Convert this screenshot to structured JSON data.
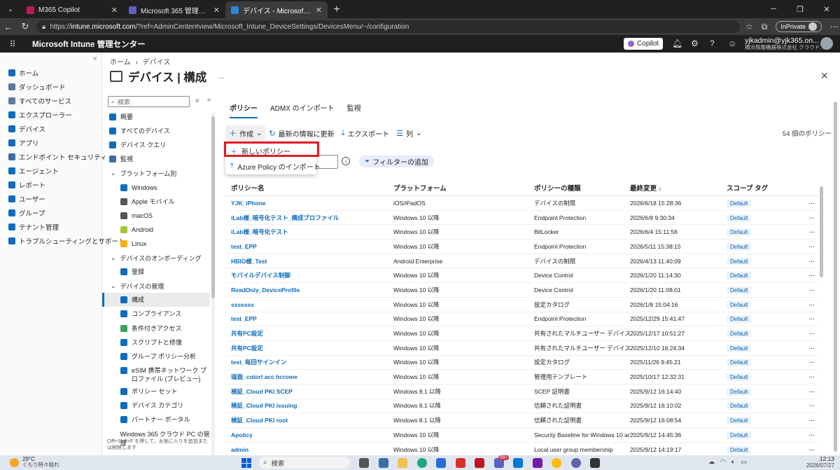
{
  "browser": {
    "tabs": [
      {
        "title": "M365 Copilot",
        "color": "#c2185b"
      },
      {
        "title": "Microsoft 365 管理センター",
        "color": "#5b5fc7"
      },
      {
        "title": "デバイス - Microsoft Intune 管理セン",
        "color": "#2b88d8"
      }
    ],
    "url_prefix": "https://",
    "url_host": "intune.microsoft.com",
    "url_path": "/?ref=AdminCenter#view/Microsoft_Intune_DeviceSettings/DevicesMenu/~/configuration",
    "inprivate_label": "InPrivate"
  },
  "header": {
    "app_title": "Microsoft Intune 管理センター",
    "copilot_label": "Copilot",
    "account_name": "yjkadmin@yjk365.on...",
    "account_org": "横浜情報機器株式会社 クラウド..."
  },
  "sidebar": {
    "items": [
      {
        "label": "ホーム",
        "icon": "home-icon",
        "color": "#0f6cbd"
      },
      {
        "label": "ダッシュボード",
        "icon": "dashboard-icon",
        "color": "#5c7a99"
      },
      {
        "label": "すべてのサービス",
        "icon": "all-services-icon",
        "color": "#5c7a99"
      },
      {
        "label": "エクスプローラー",
        "icon": "explorer-icon",
        "color": "#0f6cbd"
      },
      {
        "label": "デバイス",
        "icon": "devices-icon",
        "color": "#0f6cbd"
      },
      {
        "label": "アプリ",
        "icon": "apps-icon",
        "color": "#0f6cbd"
      },
      {
        "label": "エンドポイント セキュリティ",
        "icon": "endpoint-security-icon",
        "color": "#3a6ea5"
      },
      {
        "label": "エージェント",
        "icon": "agents-icon",
        "color": "#0f6cbd"
      },
      {
        "label": "レポート",
        "icon": "reports-icon",
        "color": "#0f6cbd"
      },
      {
        "label": "ユーザー",
        "icon": "users-icon",
        "color": "#0f6cbd"
      },
      {
        "label": "グループ",
        "icon": "groups-icon",
        "color": "#0f6cbd"
      },
      {
        "label": "テナント管理",
        "icon": "tenant-admin-icon",
        "color": "#0f6cbd"
      },
      {
        "label": "トラブルシューティングとサポート",
        "icon": "troubleshooting-icon",
        "color": "#0f6cbd"
      }
    ]
  },
  "page": {
    "breadcrumb_home": "ホーム",
    "breadcrumb_sep": "›",
    "breadcrumb_current": "デバイス",
    "title": "デバイス | 構成",
    "more": "...",
    "close": "✕"
  },
  "submenu": {
    "search_placeholder": "検索",
    "items": [
      {
        "label": "概要",
        "color": "#0f6cbd"
      },
      {
        "label": "すべてのデバイス",
        "color": "#0f6cbd"
      },
      {
        "label": "デバイス クエリ",
        "color": "#0f6cbd"
      },
      {
        "label": "監視",
        "color": "#3a6ea5"
      }
    ],
    "group_platform": "プラットフォーム別",
    "platform_items": [
      {
        "label": "Windows",
        "color": "#0f6cbd"
      },
      {
        "label": "Apple モバイル",
        "color": "#555"
      },
      {
        "label": "macOS",
        "color": "#555"
      },
      {
        "label": "Android",
        "color": "#a4c639"
      },
      {
        "label": "Linux",
        "color": "#f0b400"
      }
    ],
    "group_onboarding": "デバイスのオンボーディング",
    "onboarding_items": [
      {
        "label": "登録",
        "color": "#0f6cbd"
      }
    ],
    "group_management": "デバイスの管理",
    "management_items": [
      {
        "label": "構成",
        "color": "#0f6cbd"
      },
      {
        "label": "コンプライアンス",
        "color": "#0f6cbd"
      },
      {
        "label": "条件付きアクセス",
        "color": "#3ba55c"
      },
      {
        "label": "スクリプトと修復",
        "color": "#0f6cbd"
      },
      {
        "label": "グループ ポリシー分析",
        "color": "#0f6cbd"
      },
      {
        "label": "eSIM 携帯ネットワーク プロファイル (プレビュー)",
        "color": "#0f6cbd"
      },
      {
        "label": "ポリシー セット",
        "color": "#0f6cbd"
      },
      {
        "label": "デバイス カテゴリ",
        "color": "#0f6cbd"
      },
      {
        "label": "パートナー ポータル",
        "color": "#0f6cbd"
      }
    ],
    "group_w365": "Windows 365 クラウド PC の管理",
    "hint": "Ctrl+Shift+F を押して、お気に入りを追加または削除します"
  },
  "tabs": [
    {
      "label": "ポリシー",
      "active": true
    },
    {
      "label": "ADMX のインポート",
      "active": false
    },
    {
      "label": "監視",
      "active": false
    }
  ],
  "toolbar": {
    "create": "作成",
    "refresh": "最新の情報に更新",
    "export": "エクスポート",
    "columns": "列",
    "count": "54 個のポリシー"
  },
  "dropdown": {
    "new_policy": "新しいポリシー",
    "import_azure": "Azure Policy のインポート"
  },
  "filter": {
    "add_filter": "フィルターの追加"
  },
  "table": {
    "columns": [
      "ポリシー名",
      "プラットフォーム",
      "ポリシーの種類",
      "最終変更 ↓",
      "スコープ タグ"
    ],
    "rows": [
      {
        "name": "YJK_iPhone",
        "platform": "iOS/iPadOS",
        "type": "デバイスの制限",
        "modified": "2026/6/18 15:28:36",
        "tag": "Default"
      },
      {
        "name": "iLab様_暗号化テスト_構成プロファイル",
        "platform": "Windows 10 以降",
        "type": "Endpoint Protection",
        "modified": "2026/6/8 9:30:34",
        "tag": "Default"
      },
      {
        "name": "iLab様_暗号化テスト",
        "platform": "Windows 10 以降",
        "type": "BitLocker",
        "modified": "2026/6/4 15:11:56",
        "tag": "Default"
      },
      {
        "name": "test_EPP",
        "platform": "Windows 10 以降",
        "type": "Endpoint Protection",
        "modified": "2026/5/11 15:38:15",
        "tag": "Default"
      },
      {
        "name": "HBIO様_Test",
        "platform": "Android Enterprise",
        "type": "デバイスの制限",
        "modified": "2026/4/13 11:40:09",
        "tag": "Default"
      },
      {
        "name": "モバイルデバイス制御",
        "platform": "Windows 10 以降",
        "type": "Device Control",
        "modified": "2026/1/20 11:14:30",
        "tag": "Default"
      },
      {
        "name": "ReadOnly_DeviceProfile",
        "platform": "Windows 10 以降",
        "type": "Device Control",
        "modified": "2026/1/20 11:08:01",
        "tag": "Default"
      },
      {
        "name": "sssssss",
        "platform": "Windows 10 以降",
        "type": "設定カタログ",
        "modified": "2026/1/8 15:04:16",
        "tag": "Default"
      },
      {
        "name": "test_EPP",
        "platform": "Windows 10 以降",
        "type": "Endpoint Protection",
        "modified": "2025/12/29 15:41:47",
        "tag": "Default"
      },
      {
        "name": "共有PC設定",
        "platform": "Windows 10 以降",
        "type": "共有されたマルチユーザー デバイス",
        "modified": "2025/12/17 10:51:27",
        "tag": "Default"
      },
      {
        "name": "共有PC設定",
        "platform": "Windows 10 以降",
        "type": "共有されたマルチユーザー デバイス",
        "modified": "2025/12/10 16:24:34",
        "tag": "Default"
      },
      {
        "name": "test_毎回サインイン",
        "platform": "Windows 10 以降",
        "type": "設定カタログ",
        "modified": "2025/11/26 9:45:21",
        "tag": "Default"
      },
      {
        "name": "瑞翁_cotorl acc hcrome",
        "platform": "Windows 10 以降",
        "type": "管理用テンプレート",
        "modified": "2025/10/17 12:32:31",
        "tag": "Default"
      },
      {
        "name": "検証_Cloud PKI SCEP",
        "platform": "Windows 8.1 以降",
        "type": "SCEP 証明書",
        "modified": "2025/9/12 16:14:40",
        "tag": "Default"
      },
      {
        "name": "検証_Cloud PKI issuing",
        "platform": "Windows 8.1 以降",
        "type": "信頼された証明書",
        "modified": "2025/9/12 16:10:02",
        "tag": "Default"
      },
      {
        "name": "検証_Cloud PKI root",
        "platform": "Windows 8.1 以降",
        "type": "信頼された証明書",
        "modified": "2025/9/12 16:08:54",
        "tag": "Default"
      },
      {
        "name": "Apolicy",
        "platform": "Windows 10 以降",
        "type": "Security Baseline for Windows 10 and",
        "modified": "2025/9/12 14:45:36",
        "tag": "Default"
      },
      {
        "name": "admin",
        "platform": "Windows 10 以降",
        "type": "Local user group membership",
        "modified": "2025/9/12 14:19:17",
        "tag": "Default"
      }
    ],
    "row_more": "···"
  },
  "taskbar": {
    "temp": "29°C",
    "weather": "くもり時々晴れ",
    "search": "検索",
    "time": "12:13",
    "date": "2026/07/27",
    "notification_badge": "99+"
  },
  "colors": {
    "accent": "#0f6cbd",
    "highlight": "#e01b24",
    "header_bg": "#1f1f1f"
  }
}
